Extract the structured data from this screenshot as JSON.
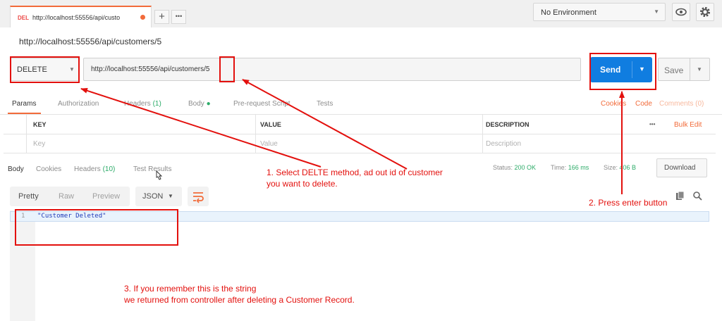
{
  "tab": {
    "method": "DEL",
    "url": "http://localhost:55556/api/custo",
    "plus": "+",
    "more": "•••"
  },
  "environment": {
    "selected": "No Environment"
  },
  "request": {
    "name": "http://localhost:55556/api/customers/5",
    "method": "DELETE",
    "url": "http://localhost:55556/api/customers/5",
    "send_label": "Send",
    "save_label": "Save"
  },
  "request_tabs": {
    "params": "Params",
    "authorization": "Authorization",
    "headers": "Headers",
    "headers_count": "(1)",
    "body": "Body",
    "prerequest": "Pre-request Script",
    "tests": "Tests",
    "cookies": "Cookies",
    "code": "Code",
    "comments": "Comments (0)"
  },
  "params_table": {
    "headers": [
      "KEY",
      "VALUE",
      "DESCRIPTION"
    ],
    "placeholders": [
      "Key",
      "Value",
      "Description"
    ],
    "more": "•••",
    "bulk_edit": "Bulk Edit"
  },
  "response_tabs": {
    "body": "Body",
    "cookies": "Cookies",
    "headers": "Headers",
    "headers_count": "(10)",
    "test_results": "Test Results"
  },
  "response_status": {
    "status_label": "Status:",
    "status_value": "200 OK",
    "time_label": "Time:",
    "time_value": "166 ms",
    "size_label": "Size:",
    "size_value": "406 B",
    "download": "Download"
  },
  "response_view": {
    "formats": [
      "Pretty",
      "Raw",
      "Preview"
    ],
    "type": "JSON",
    "line_number": "1",
    "content": "\"Customer Deleted\""
  },
  "annotations": {
    "note1_line1": "1. Select DELTE method, ad out id of customer",
    "note1_line2": "you want to delete.",
    "note2": "2. Press enter button",
    "note3_line1": "3. If you remember this is the string",
    "note3_line2": "we returned from controller after deleting a Customer Record."
  },
  "colors": {
    "accent": "#f26b3a",
    "send": "#107de0",
    "annotation": "#e3100d",
    "success": "#2cab68"
  }
}
